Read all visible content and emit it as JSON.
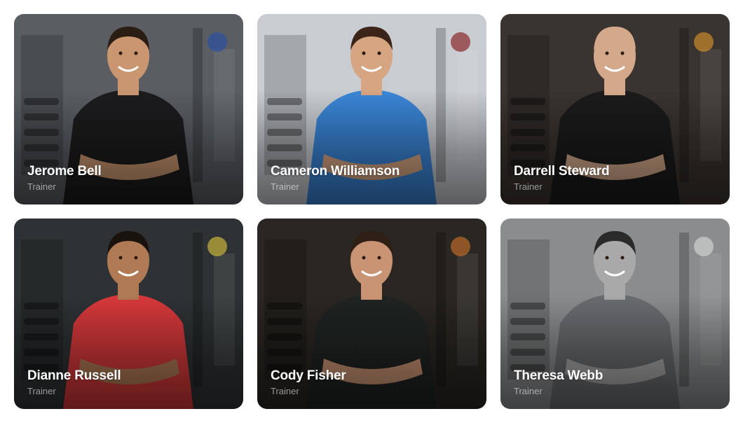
{
  "trainers": [
    {
      "name": "Jerome Bell",
      "role": "Trainer",
      "shirt": "#1c1c1e",
      "bg": "#5a5e63",
      "skin": "#c9966f",
      "hair": "#2a1d14",
      "accent": "#2a4fa0"
    },
    {
      "name": "Cameron Williamson",
      "role": "Trainer",
      "shirt": "#3a86d8",
      "bg": "#c9cdd2",
      "skin": "#d6a582",
      "hair": "#3a2518",
      "accent": "#8a2a2a"
    },
    {
      "name": "Darrell Steward",
      "role": "Trainer",
      "shirt": "#1b1b1b",
      "bg": "#3a3430",
      "skin": "#d4a88a",
      "hair": "#d4a88a",
      "accent": "#c98a2a"
    },
    {
      "name": "Dianne Russell",
      "role": "Trainer",
      "shirt": "#d8393b",
      "bg": "#2e3234",
      "skin": "#b07a55",
      "hair": "#1a120c",
      "accent": "#c8b23a"
    },
    {
      "name": "Cody Fisher",
      "role": "Trainer",
      "shirt": "#1f2422",
      "bg": "#2a2622",
      "skin": "#c99474",
      "hair": "#2f1f14",
      "accent": "#b96a2a"
    },
    {
      "name": "Theresa Webb",
      "role": "Trainer",
      "shirt": "#6a6d70",
      "bg": "#8a8c8e",
      "skin": "#a9a9a9",
      "hair": "#2a2a2a",
      "accent": "#d0d0d0"
    }
  ]
}
